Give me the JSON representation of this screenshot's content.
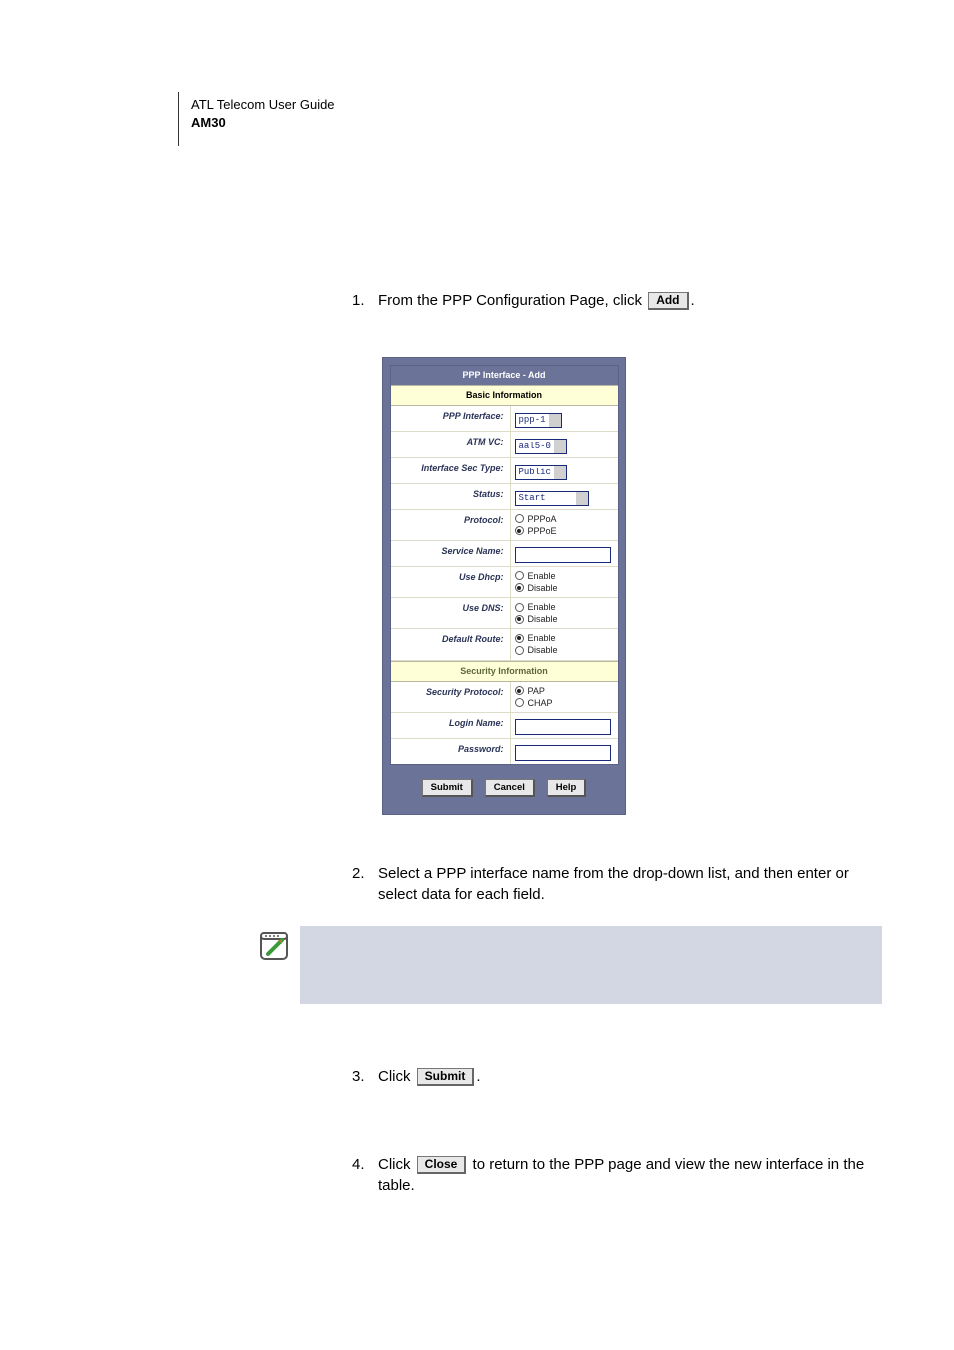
{
  "header": {
    "line1": "ATL Telecom User Guide",
    "line2": "AM30"
  },
  "buttons": {
    "add": "Add",
    "submit_inline": "Submit",
    "close": "Close"
  },
  "steps": {
    "s1_num": "1.",
    "s1_text_pre": "From the PPP Configuration Page, click ",
    "s1_text_post": ".",
    "s2_num": "2.",
    "s2_text": "Select a PPP interface name from the drop-down list, and then enter or select data for each field.",
    "s3_num": "3.",
    "s3_text_pre": "Click ",
    "s3_text_post": ".",
    "s4_num": "4.",
    "s4_text_pre": "Click ",
    "s4_text_post": " to return to the PPP page and view the new interface in the table."
  },
  "form": {
    "title": "PPP Interface - Add",
    "section1": "Basic Information",
    "section2": "Security Information",
    "labels": {
      "ppp_interface": "PPP Interface:",
      "atm_vc": "ATM VC:",
      "sec_type": "Interface Sec Type:",
      "status": "Status:",
      "protocol": "Protocol:",
      "service_name": "Service Name:",
      "use_dhcp": "Use Dhcp:",
      "use_dns": "Use DNS:",
      "default_route": "Default Route:",
      "sec_protocol": "Security Protocol:",
      "login_name": "Login Name:",
      "password": "Password:"
    },
    "values": {
      "ppp_interface": "ppp-1",
      "atm_vc": "aal5-0",
      "sec_type": "Public",
      "status": "Start",
      "service_name": "",
      "login_name": "",
      "password": ""
    },
    "radios": {
      "pppoa": "PPPoA",
      "pppoe": "PPPoE",
      "enable": "Enable",
      "disable": "Disable",
      "pap": "PAP",
      "chap": "CHAP"
    },
    "buttons": {
      "submit": "Submit",
      "cancel": "Cancel",
      "help": "Help"
    }
  }
}
